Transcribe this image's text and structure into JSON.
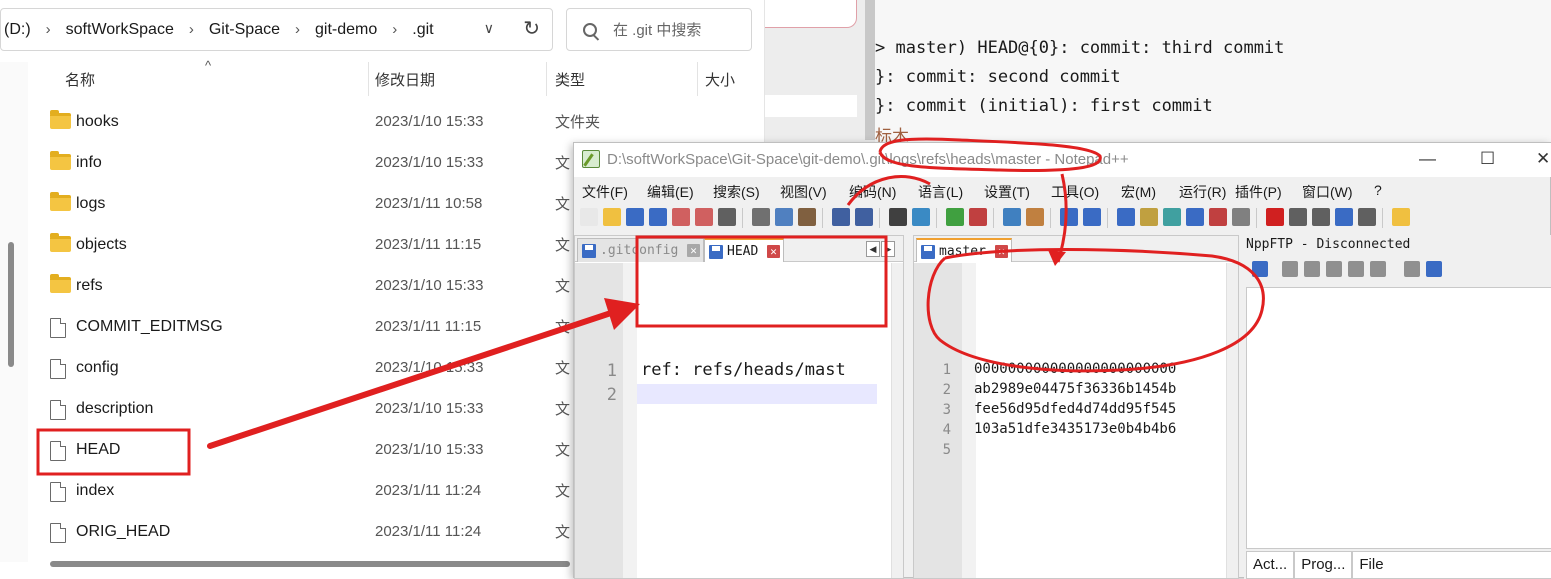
{
  "terminal": {
    "lines": [
      "> master) HEAD@{0}: commit: third commit",
      "}: commit: second commit",
      "}: commit (initial): first commit"
    ],
    "cut_text": "标木"
  },
  "explorer": {
    "breadcrumb": [
      "(D:)",
      "softWorkSpace",
      "Git-Space",
      "git-demo",
      ".git"
    ],
    "search_placeholder": "在 .git 中搜索",
    "columns": {
      "name": "名称",
      "modified": "修改日期",
      "type": "类型",
      "size": "大小"
    },
    "rows": [
      {
        "name": "hooks",
        "modified": "2023/1/10 15:33",
        "type": "文件夹",
        "kind": "folder-icon"
      },
      {
        "name": "info",
        "modified": "2023/1/10 15:33",
        "type": "文",
        "kind": "folder-icon"
      },
      {
        "name": "logs",
        "modified": "2023/1/11 10:58",
        "type": "文",
        "kind": "folder-icon"
      },
      {
        "name": "objects",
        "modified": "2023/1/11 11:15",
        "type": "文",
        "kind": "folder-icon"
      },
      {
        "name": "refs",
        "modified": "2023/1/10 15:33",
        "type": "文",
        "kind": "folder-icon"
      },
      {
        "name": "COMMIT_EDITMSG",
        "modified": "2023/1/11 11:15",
        "type": "文",
        "kind": "file-icon"
      },
      {
        "name": "config",
        "modified": "2023/1/10 15:33",
        "type": "文",
        "kind": "file-icon"
      },
      {
        "name": "description",
        "modified": "2023/1/10 15:33",
        "type": "文",
        "kind": "file-icon"
      },
      {
        "name": "HEAD",
        "modified": "2023/1/10 15:33",
        "type": "文",
        "kind": "file-icon"
      },
      {
        "name": "index",
        "modified": "2023/1/11 11:24",
        "type": "文",
        "kind": "file-icon"
      },
      {
        "name": "ORIG_HEAD",
        "modified": "2023/1/11 11:24",
        "type": "文",
        "kind": "file-icon"
      }
    ]
  },
  "npp": {
    "title": "D:\\softWorkSpace\\Git-Space\\git-demo\\.git\\logs\\refs\\heads\\master - Notepad++",
    "menu": [
      "文件(F)",
      "编辑(E)",
      "搜索(S)",
      "视图(V)",
      "编码(N)",
      "语言(L)",
      "设置(T)",
      "工具(O)",
      "宏(M)",
      "运行(R)",
      "插件(P)",
      "窗口(W)",
      "?"
    ],
    "left_tabs": [
      ".gitconfig",
      "HEAD"
    ],
    "left_lines": [
      "ref: refs/heads/mast",
      ""
    ],
    "right_tab": "master",
    "right_lines": [
      "000000000000000000000000",
      "ab2989e04475f36336b1454b",
      "fee56d95dfed4d74dd95f545",
      "103a51dfe3435173e0b4b4b6",
      ""
    ],
    "ftp_title": "NppFTP - Disconnected",
    "ftp_tabs": [
      "Act...",
      "Prog...",
      "File"
    ]
  },
  "colors": {
    "annotation": "#e02020",
    "tab_accent": "#f0a030",
    "folder": "#f4c542"
  }
}
